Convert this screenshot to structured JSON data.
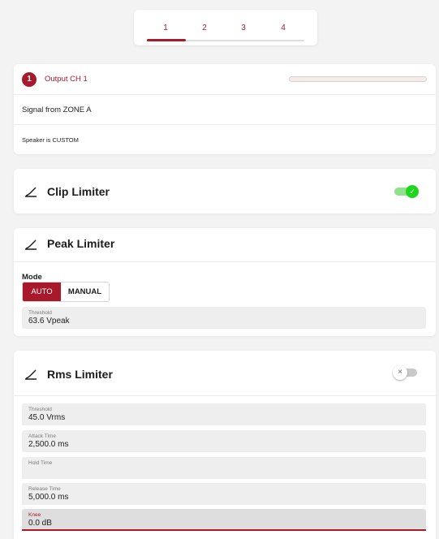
{
  "tabs": [
    "1",
    "2",
    "3",
    "4"
  ],
  "output": {
    "badge": "1",
    "title": "Output CH 1",
    "level_fraction": 0.0,
    "signal": "Signal from ZONE A",
    "speaker": "Speaker is CUSTOM"
  },
  "clip_limiter": {
    "title": "Clip Limiter",
    "enabled": true,
    "icon": "limiter-icon",
    "check_glyph": "✓"
  },
  "peak_limiter": {
    "title": "Peak Limiter",
    "mode_label": "Mode",
    "mode_options": [
      "AUTO",
      "MANUAL"
    ],
    "threshold_label": "Threshold",
    "threshold_value": "63.6  Vpeak"
  },
  "rms_limiter": {
    "title": "Rms Limiter",
    "enabled": false,
    "off_glyph": "×",
    "fields": [
      {
        "label": "Threshold",
        "value": "45.0  Vrms"
      },
      {
        "label": "Attack Time",
        "value": "2,500.0  ms"
      },
      {
        "label": "Hold Time",
        "value": ""
      },
      {
        "label": "Release Time",
        "value": "5,000.0  ms"
      },
      {
        "label": "Knee",
        "value": "0.0  dB"
      }
    ]
  },
  "colors": {
    "accent": "#a8192b",
    "toggle_on": "#1fd61f"
  }
}
